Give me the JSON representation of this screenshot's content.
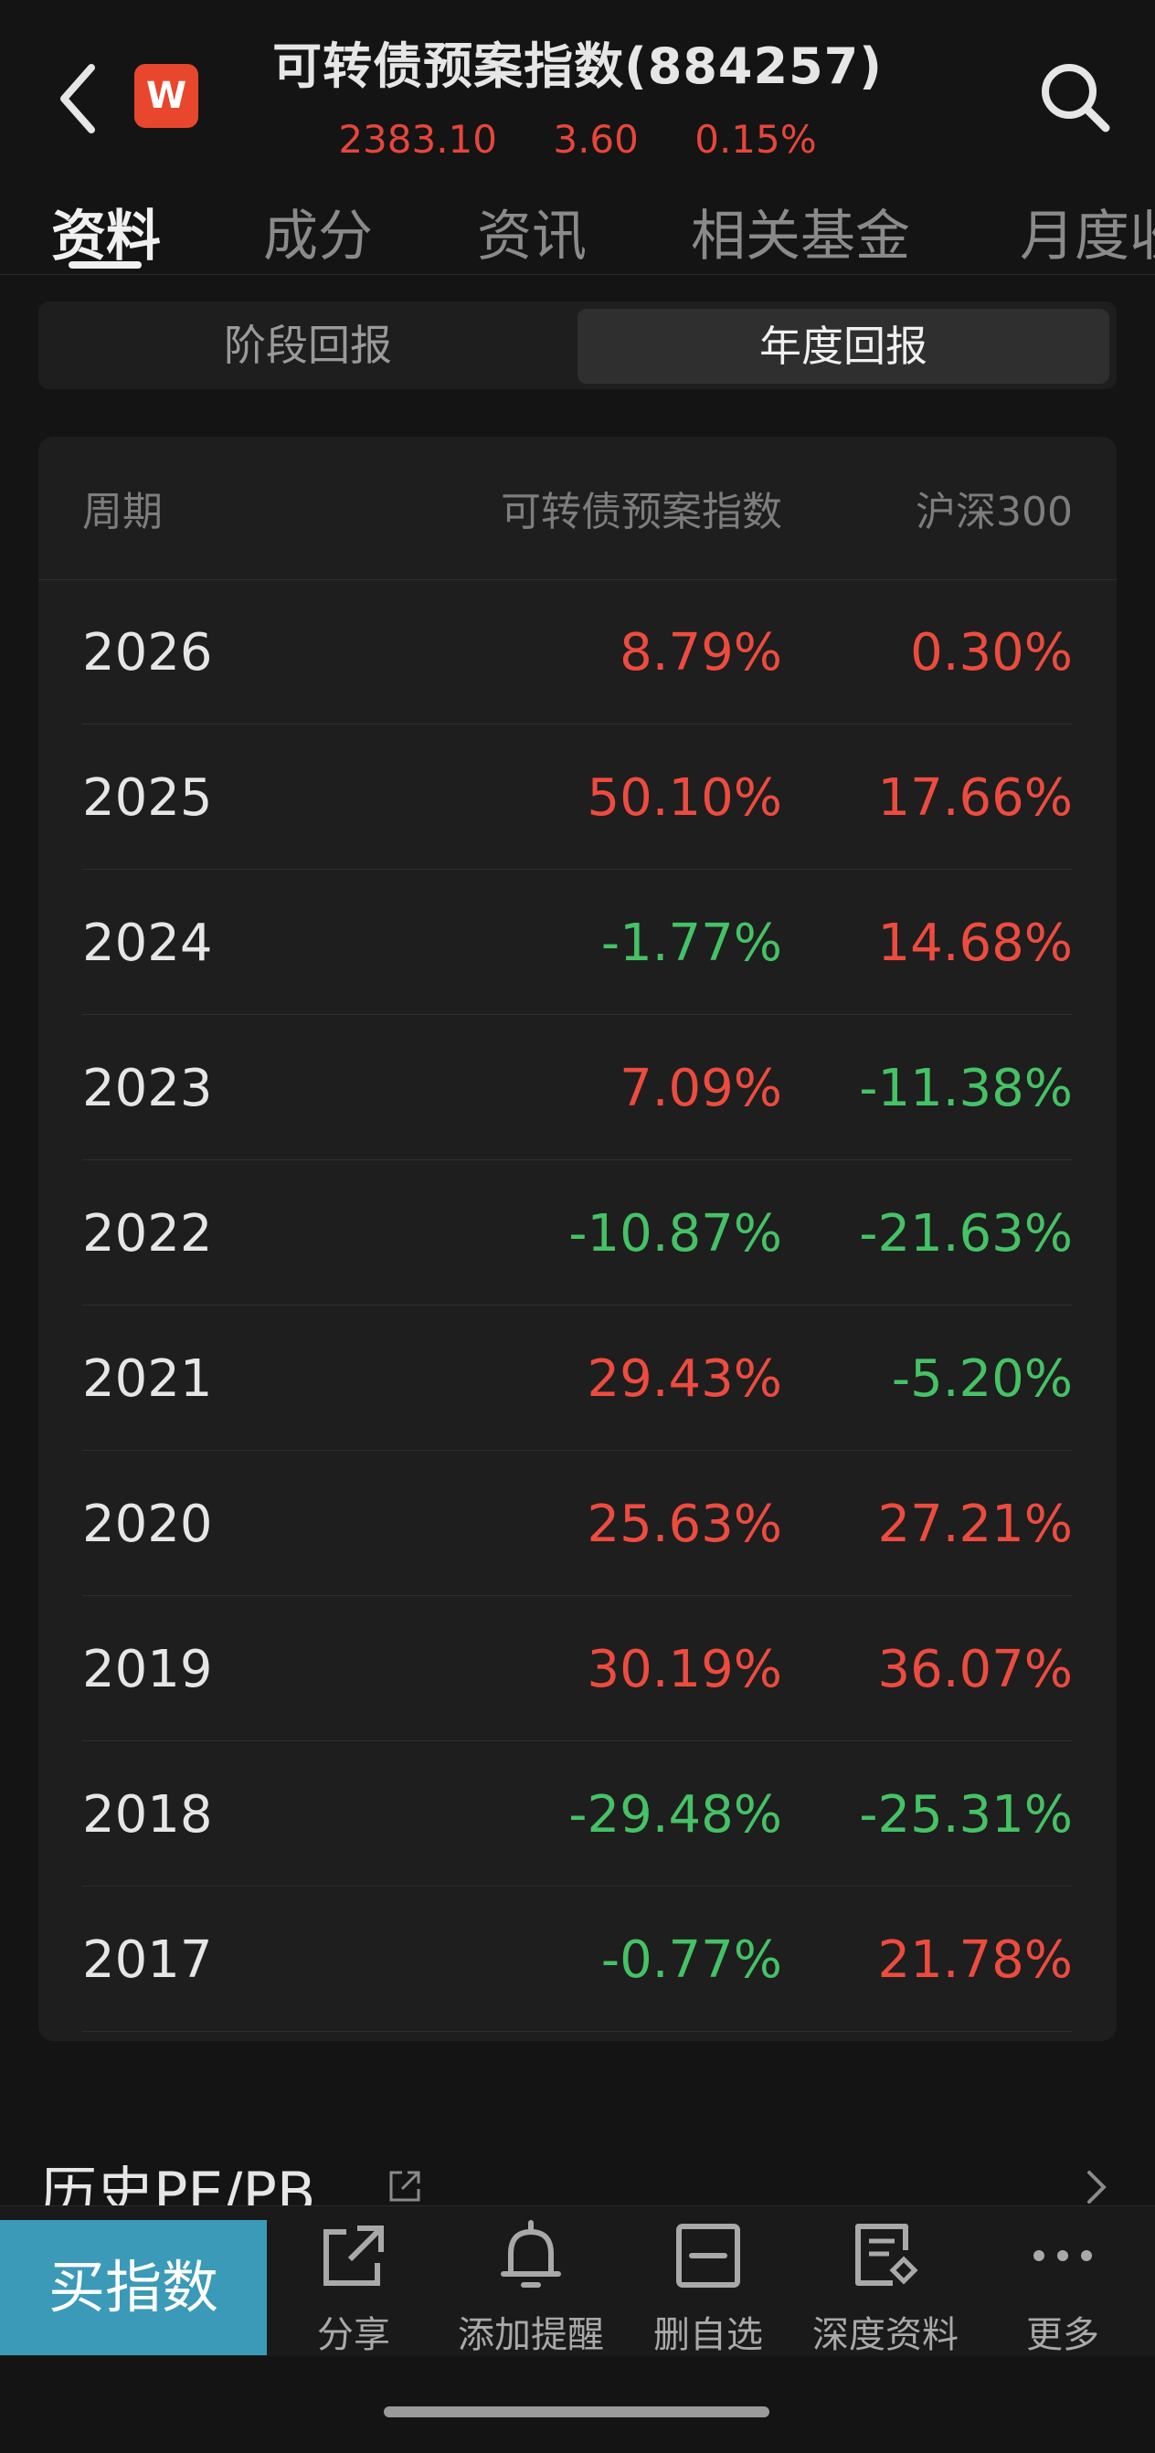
{
  "header": {
    "title": "可转债预案指数(884257)",
    "logo_text": "W",
    "price": "2383.10",
    "change": "3.60",
    "change_pct": "0.15%"
  },
  "tabs": [
    {
      "label": "资料",
      "active": true
    },
    {
      "label": "成分"
    },
    {
      "label": "资讯"
    },
    {
      "label": "相关基金"
    },
    {
      "label": "月度收"
    }
  ],
  "segment": {
    "options": [
      "阶段回报",
      "年度回报"
    ],
    "selected": "年度回报"
  },
  "table": {
    "headers": [
      "周期",
      "可转债预案指数",
      "沪深300"
    ],
    "rows": [
      {
        "year": "2026",
        "index": "8.79%",
        "hs300": "0.30%"
      },
      {
        "year": "2025",
        "index": "50.10%",
        "hs300": "17.66%"
      },
      {
        "year": "2024",
        "index": "-1.77%",
        "hs300": "14.68%"
      },
      {
        "year": "2023",
        "index": "7.09%",
        "hs300": "-11.38%"
      },
      {
        "year": "2022",
        "index": "-10.87%",
        "hs300": "-21.63%"
      },
      {
        "year": "2021",
        "index": "29.43%",
        "hs300": "-5.20%"
      },
      {
        "year": "2020",
        "index": "25.63%",
        "hs300": "27.21%"
      },
      {
        "year": "2019",
        "index": "30.19%",
        "hs300": "36.07%"
      },
      {
        "year": "2018",
        "index": "-29.48%",
        "hs300": "-25.31%"
      },
      {
        "year": "2017",
        "index": "-0.77%",
        "hs300": "21.78%"
      }
    ]
  },
  "pe_section": {
    "title": "历史PE/PB"
  },
  "bottom_bar": {
    "buy_label": "买指数",
    "actions": [
      {
        "label": "分享",
        "icon": "share-icon"
      },
      {
        "label": "添加提醒",
        "icon": "bell-icon"
      },
      {
        "label": "删自选",
        "icon": "remove-watchlist-icon"
      },
      {
        "label": "深度资料",
        "icon": "deep-data-icon"
      },
      {
        "label": "更多",
        "icon": "more-icon"
      }
    ]
  },
  "colors": {
    "up": "#ee4b3f",
    "down": "#45c265",
    "accent": "#3b9ab8",
    "background": "#141414"
  }
}
